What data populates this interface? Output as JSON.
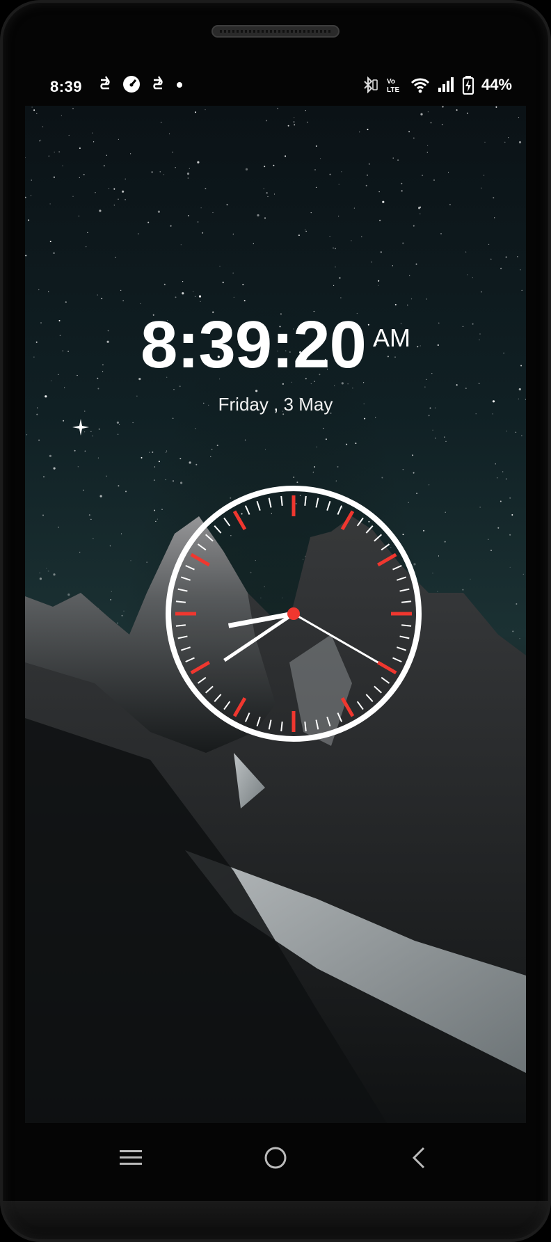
{
  "status_bar": {
    "time": "8:39",
    "left_icons": [
      "sync-icon",
      "speedometer-icon",
      "sync-icon",
      "dot-icon"
    ],
    "right_icons": [
      "bluetooth-icon",
      "volte-icon",
      "wifi-icon",
      "signal-icon",
      "battery-charging-icon"
    ],
    "volte_label": "Vo)) LTE",
    "battery_percent": "44%"
  },
  "clock": {
    "time": "8:39:20",
    "ampm": "AM",
    "date": "Friday , 3 May",
    "hour": 8,
    "minute": 39,
    "second": 20
  },
  "colors": {
    "accent_tick": "#f0372f",
    "face_ring": "#ffffff",
    "center_dot": "#f0372f"
  },
  "nav_bar": {
    "recent_label": "recent-apps-icon",
    "home_label": "home-icon",
    "back_label": "back-icon"
  }
}
